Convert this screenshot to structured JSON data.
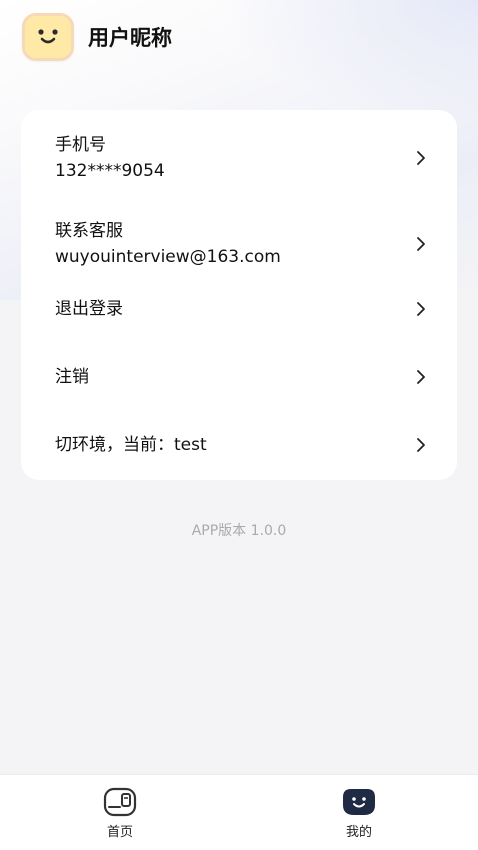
{
  "profile": {
    "nickname": "用户昵称",
    "avatar_icon": "smiley-face-icon",
    "avatar_color": "#ffe9a6"
  },
  "menu": {
    "items": [
      {
        "label": "手机号",
        "value": "132****9054",
        "icon": "chevron-right-icon"
      },
      {
        "label": "联系客服",
        "value": "wuyouinterview@163.com",
        "icon": "chevron-right-icon"
      },
      {
        "label": "退出登录",
        "icon": "chevron-right-icon"
      },
      {
        "label": "注销",
        "icon": "chevron-right-icon"
      },
      {
        "label": "切环境，当前：test",
        "icon": "chevron-right-icon"
      }
    ]
  },
  "version_text": "APP版本 1.0.0",
  "tabbar": {
    "tabs": [
      {
        "label": "首页",
        "icon": "home-card-icon",
        "active": false
      },
      {
        "label": "我的",
        "icon": "smiley-face-icon",
        "active": true,
        "active_color": "#1f2a44"
      }
    ]
  }
}
